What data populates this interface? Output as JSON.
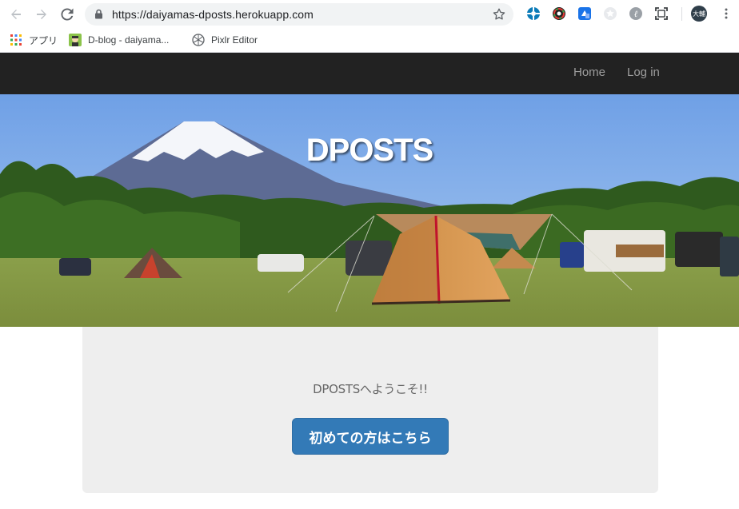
{
  "browser": {
    "url": "https://daiyamas-dposts.herokuapp.com",
    "profile_initials": "大輔",
    "bookmarks": [
      {
        "label": "アプリ",
        "icon": "apps-grid-icon"
      },
      {
        "label": "D-blog - daiyama...",
        "icon": "d-blog-favicon"
      },
      {
        "label": "Pixlr Editor",
        "icon": "pixlr-icon"
      }
    ],
    "extensions": [
      "extension-blue-icon",
      "extension-color-wheel-icon",
      "extension-g-icon",
      "extension-star-icon",
      "extension-e-icon",
      "screenshot-frame-icon"
    ]
  },
  "navbar": {
    "links": [
      "Home",
      "Log in"
    ],
    "background": "#222222"
  },
  "hero": {
    "title": "DPOSTS"
  },
  "jumbotron": {
    "welcome_text": "DPOSTSへようこそ!!",
    "button_label": "初めての方はこちら",
    "button_color": "#337ab7"
  }
}
